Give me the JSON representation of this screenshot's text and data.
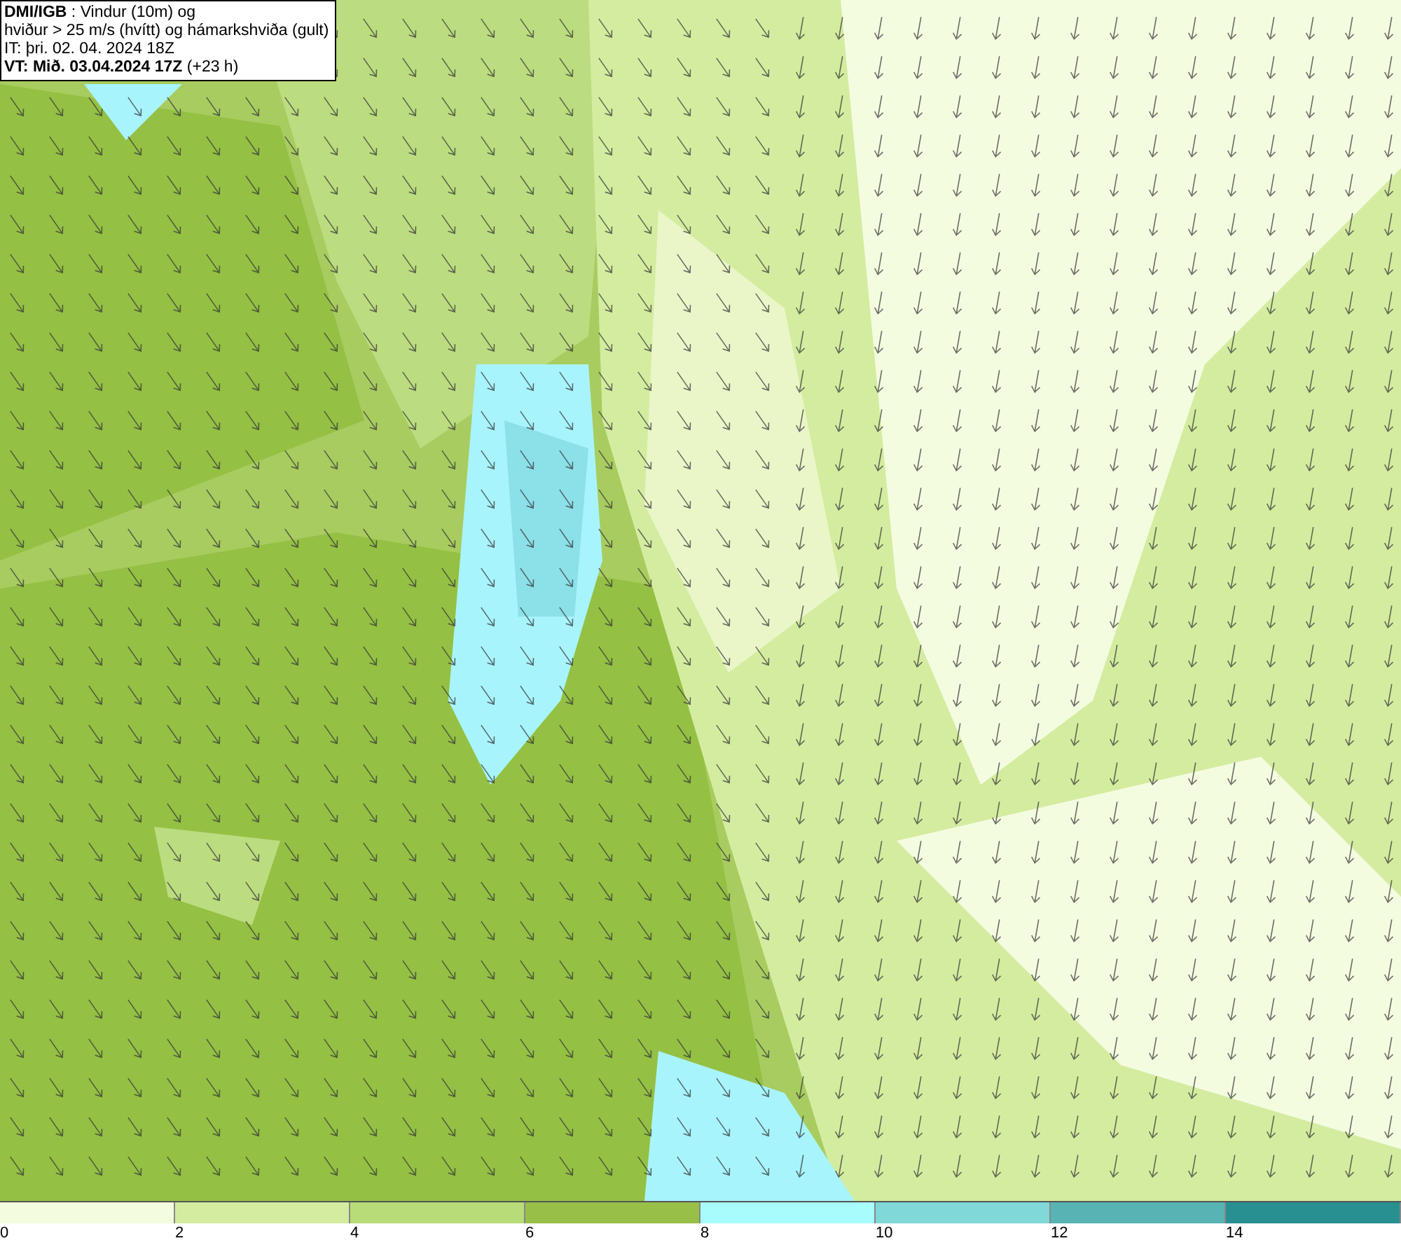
{
  "info_box": {
    "lines": [
      "**DMI/IGB** : Vindur (10m) og",
      "hviður > 25 m/s (hvítt) og hámarkshviða (gult)",
      "IT: þri. 02. 04. 2024 18Z",
      "**VT: Mið. 03.04.2024 17Z** (+23 h)"
    ]
  },
  "legend": [
    {
      "label": "0",
      "color": "#f4fce0"
    },
    {
      "label": "2",
      "color": "#d4eca0"
    },
    {
      "label": "4",
      "color": "#b8dc78"
    },
    {
      "label": "6",
      "color": "#98c048"
    },
    {
      "label": "8",
      "color": "#a8fcfc"
    },
    {
      "label": "10",
      "color": "#80d8d8"
    },
    {
      "label": "12",
      "color": "#58b4b4"
    },
    {
      "label": "14",
      "color": "#289090"
    }
  ]
}
